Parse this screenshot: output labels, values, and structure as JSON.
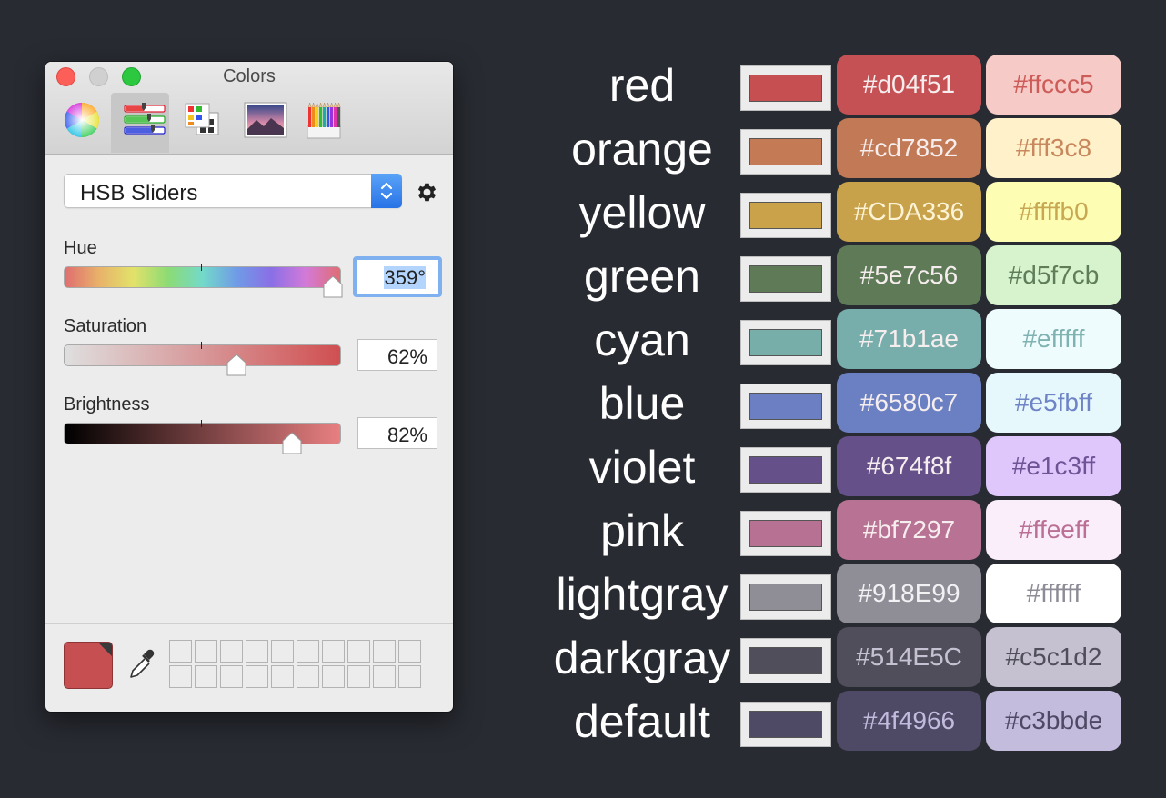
{
  "window": {
    "title": "Colors",
    "toolbar": [
      {
        "name": "color-wheel",
        "icon": "color-wheel-icon",
        "selected": false
      },
      {
        "name": "color-sliders",
        "icon": "sliders-icon",
        "selected": true
      },
      {
        "name": "color-palettes",
        "icon": "palettes-icon",
        "selected": false
      },
      {
        "name": "image-palettes",
        "icon": "image-palette-icon",
        "selected": false
      },
      {
        "name": "pencils",
        "icon": "pencils-icon",
        "selected": false
      }
    ],
    "mode_select": "HSB Sliders",
    "sliders": {
      "hue": {
        "label": "Hue",
        "value": "359°",
        "level": 1.0
      },
      "saturation": {
        "label": "Saturation",
        "value": "62%",
        "level": 0.62
      },
      "brightness": {
        "label": "Brightness",
        "value": "82%",
        "level": 0.82
      }
    },
    "current_color": "#c54f51"
  },
  "palette": [
    {
      "name": "red",
      "dark": "#d04f51",
      "light": "#ffccc5",
      "well": "#c54f51",
      "dark_bg": "#c65154",
      "light_bg": "#f6cac6",
      "light_fg": "#cd5c58"
    },
    {
      "name": "orange",
      "dark": "#cd7852",
      "light": "#fff3c8",
      "well": "#c47a55",
      "dark_bg": "#c27955",
      "light_bg": "#fff2cb",
      "light_fg": "#c8875d"
    },
    {
      "name": "yellow",
      "dark": "#CDA336",
      "light": "#ffffb0",
      "well": "#c9a24a",
      "dark_bg": "#c8a24a",
      "light_bg": "#fefdb4",
      "light_fg": "#c7a752"
    },
    {
      "name": "green",
      "dark": "#5e7c56",
      "light": "#d5f7cb",
      "well": "#5f7a57",
      "dark_bg": "#5e7a57",
      "light_bg": "#d6f3cd",
      "light_fg": "#5f7d59"
    },
    {
      "name": "cyan",
      "dark": "#71b1ae",
      "light": "#efffff",
      "well": "#78aea9",
      "dark_bg": "#77aeab",
      "light_bg": "#effcfd",
      "light_fg": "#7fb2b0"
    },
    {
      "name": "blue",
      "dark": "#6580c7",
      "light": "#e5fbff",
      "well": "#6b7fc2",
      "dark_bg": "#6b80c3",
      "light_bg": "#e7f8fd",
      "light_fg": "#6e84c6"
    },
    {
      "name": "violet",
      "dark": "#674f8f",
      "light": "#e1c3ff",
      "well": "#66508a",
      "dark_bg": "#66508a",
      "light_bg": "#dfc6fb",
      "light_fg": "#6e5495"
    },
    {
      "name": "pink",
      "dark": "#bf7297",
      "light": "#ffeeff",
      "well": "#b67193",
      "dark_bg": "#b77294",
      "light_bg": "#fbeefb",
      "light_fg": "#bb6f95"
    },
    {
      "name": "lightgray",
      "dark": "#918E99",
      "light": "#ffffff",
      "well": "#8f8d96",
      "dark_bg": "#8f8d96",
      "light_bg": "#ffffff",
      "light_fg": "#8d8b95"
    },
    {
      "name": "darkgray",
      "dark": "#514E5C",
      "light": "#c5c1d2",
      "well": "#514e5b",
      "dark_bg": "#514e5b",
      "light_bg": "#c5c1d0",
      "light_fg": "#514e5b"
    },
    {
      "name": "default",
      "dark": "#4f4966",
      "light": "#c3bbde",
      "well": "#4e4964",
      "dark_bg": "#4e4964",
      "light_bg": "#c3bcdc",
      "light_fg": "#4e4964"
    }
  ]
}
